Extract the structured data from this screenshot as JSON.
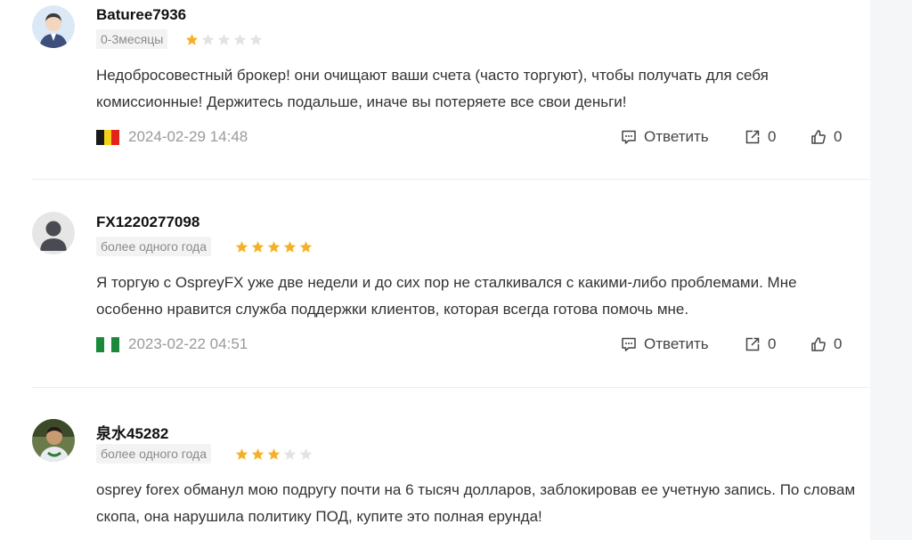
{
  "colors": {
    "star_filled": "#f5b027",
    "star_empty": "#e3e3e3",
    "tenure_bg": "#f3f3f3",
    "date_text": "#9a9a9a"
  },
  "reviews": [
    {
      "username": "Baturee7936",
      "tenure": "0-3месяцы",
      "rating": 1,
      "text": "Недобросовестный брокер! они очищают ваши счета (часто торгуют), чтобы получать для себя комиссионные! Держитесь подальше, иначе вы потеряете все свои деньги!",
      "flag": [
        "#1a1a1a",
        "#f7d117",
        "#e2231a"
      ],
      "date": "2024-02-29 14:48",
      "reply_label": "Ответить",
      "share_count": "0",
      "like_count": "0",
      "avatar": "default-user-light-icon"
    },
    {
      "username": "FX1220277098",
      "tenure": "более одного года",
      "rating": 5,
      "text": "Я торгую с OspreyFX уже две недели и до сих пор не сталкивался с какими-либо проблемами. Мне особенно нравится служба поддержки клиентов, которая всегда готова помочь мне.",
      "flag": [
        "#1a8a3a",
        "#ffffff",
        "#1a8a3a"
      ],
      "date": "2023-02-22 04:51",
      "reply_label": "Ответить",
      "share_count": "0",
      "like_count": "0",
      "avatar": "default-user-dark-icon"
    },
    {
      "username": "泉水45282",
      "tenure": "более одного года",
      "rating": 3,
      "text": "osprey forex обманул мою подругу почти на 6 тысяч долларов, заблокировав ее учетную запись. По словам скопа, она нарушила политику ПОД, купите это полная ерунда!",
      "avatar": "user-photo-avatar"
    }
  ]
}
